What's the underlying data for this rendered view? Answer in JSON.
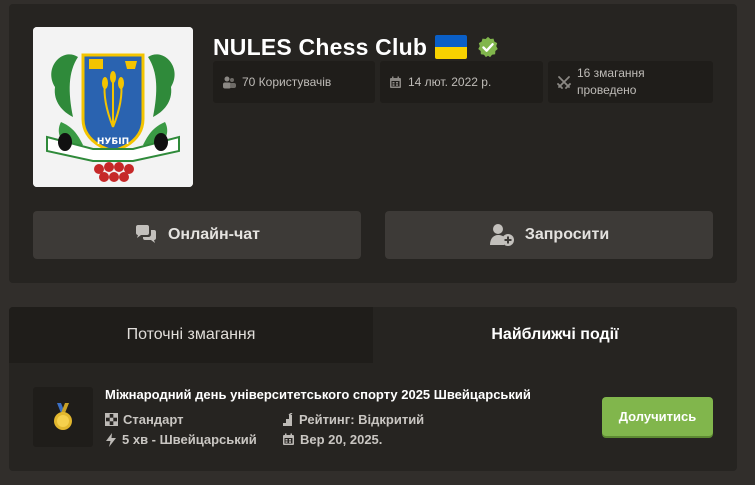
{
  "club": {
    "name": "NULES Chess Club",
    "logo_text": "НУБІП",
    "stats": {
      "members": "70 Користувачів",
      "date": "14 лют. 2022 р.",
      "events": "16 змагання проведено"
    }
  },
  "actions": {
    "chat_label": "Онлайн-чат",
    "invite_label": "Запросити"
  },
  "tabs": {
    "current": "Поточні змагання",
    "upcoming": "Найближчі події"
  },
  "event": {
    "title": "Міжнародний день університетського спорту 2025 Швейцарський",
    "type": "Стандарт",
    "time_control": "5 хв - Швейцарський",
    "rating": "Рейтинг: Відкритий",
    "date": "Вер 20, 2025.",
    "join_label": "Долучитись"
  },
  "colors": {
    "accent_green": "#81b64c",
    "card_bg": "#262421",
    "page_bg": "#312e2b"
  },
  "icons": [
    "members-icon",
    "calendar-icon",
    "crossed-swords-icon",
    "chat-icon",
    "add-user-icon",
    "verified-icon",
    "ukraine-flag-icon",
    "medal-icon",
    "board-icon",
    "rating-icon",
    "lightning-icon"
  ]
}
